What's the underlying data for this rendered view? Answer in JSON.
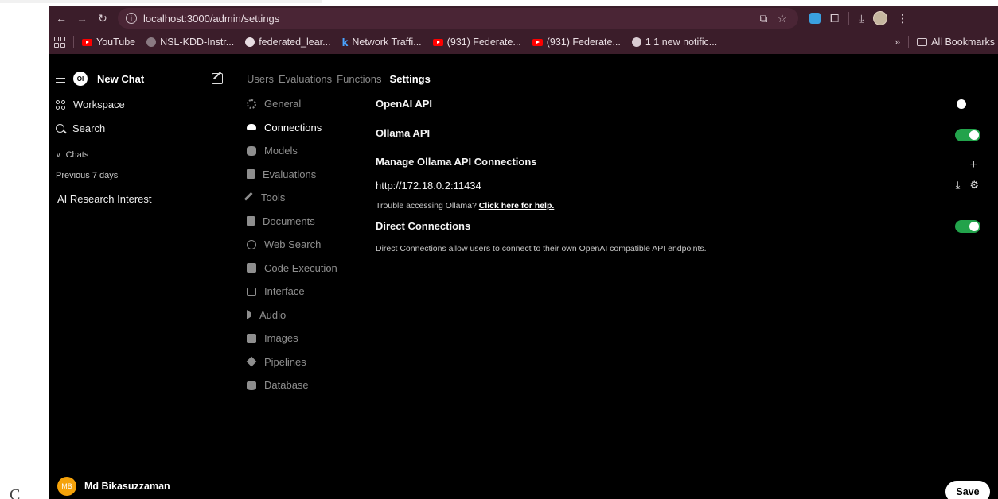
{
  "browser": {
    "url": "localhost:3000/admin/settings",
    "bookmarks": [
      {
        "label": "YouTube",
        "icon": "youtube-icon"
      },
      {
        "label": "NSL-KDD-Instr...",
        "icon": "github-icon"
      },
      {
        "label": "federated_lear...",
        "icon": "github-icon"
      },
      {
        "label": "Network Traffi...",
        "icon": "k-icon"
      },
      {
        "label": "(931) Federate...",
        "icon": "youtube-icon"
      },
      {
        "label": "(931) Federate...",
        "icon": "youtube-icon"
      },
      {
        "label": "1 1 new notific...",
        "icon": "globe-icon"
      }
    ],
    "bookmarks_more": "»",
    "all_bookmarks": "All Bookmarks"
  },
  "sidebar": {
    "logo": "OI",
    "new_chat": "New Chat",
    "workspace": "Workspace",
    "search": "Search",
    "chats_label": "Chats",
    "group_label": "Previous 7 days",
    "chat_items": [
      "AI Research Interest"
    ],
    "user": {
      "initials": "MB",
      "name": "Md Bikasuzzaman"
    }
  },
  "top_tabs": {
    "users": "Users",
    "evaluations": "Evaluations",
    "functions": "Functions",
    "settings": "Settings"
  },
  "settings_nav": [
    {
      "label": "General",
      "active": false
    },
    {
      "label": "Connections",
      "active": true
    },
    {
      "label": "Models",
      "active": false
    },
    {
      "label": "Evaluations",
      "active": false
    },
    {
      "label": "Tools",
      "active": false
    },
    {
      "label": "Documents",
      "active": false
    },
    {
      "label": "Web Search",
      "active": false
    },
    {
      "label": "Code Execution",
      "active": false
    },
    {
      "label": "Interface",
      "active": false
    },
    {
      "label": "Audio",
      "active": false
    },
    {
      "label": "Images",
      "active": false
    },
    {
      "label": "Pipelines",
      "active": false
    },
    {
      "label": "Database",
      "active": false
    }
  ],
  "main": {
    "openai_api": {
      "label": "OpenAI API",
      "enabled": false
    },
    "ollama_api": {
      "label": "Ollama API",
      "enabled": true
    },
    "manage_ollama": "Manage Ollama API Connections",
    "ollama_url": "http://172.18.0.2:11434",
    "help_text": "Trouble accessing Ollama?",
    "help_link": "Click here for help.",
    "direct_connections": {
      "label": "Direct Connections",
      "enabled": true
    },
    "direct_desc": "Direct Connections allow users to connect to their own OpenAI compatible API endpoints.",
    "save": "Save"
  },
  "colors": {
    "toggle_on": "#22a34b",
    "avatar": "#f5a20a",
    "chrome": "#3b1d2a"
  },
  "page_glyph": "C"
}
